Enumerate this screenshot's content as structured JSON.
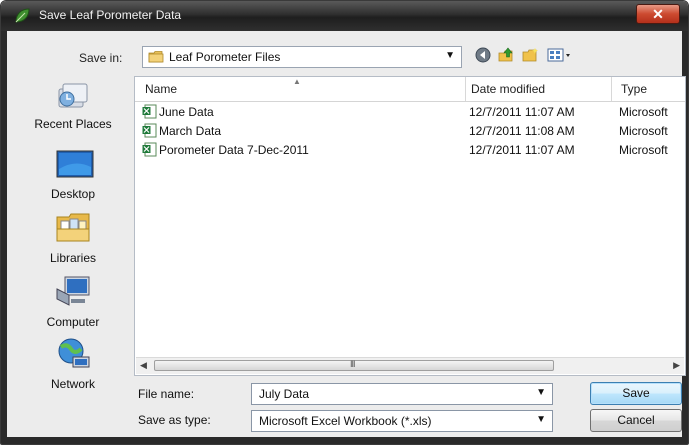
{
  "window": {
    "title": "Save Leaf Porometer Data",
    "close_symbol": "✕"
  },
  "save_in": {
    "label": "Save in:",
    "value": "Leaf Porometer Files"
  },
  "toolbar": {
    "icons": [
      "back-icon",
      "up-folder-icon",
      "new-folder-icon",
      "view-menu-icon"
    ]
  },
  "places": [
    {
      "label": "Recent Places",
      "icon": "recent-places-icon"
    },
    {
      "label": "Desktop",
      "icon": "desktop-icon"
    },
    {
      "label": "Libraries",
      "icon": "libraries-icon"
    },
    {
      "label": "Computer",
      "icon": "computer-icon"
    },
    {
      "label": "Network",
      "icon": "network-icon"
    }
  ],
  "columns": {
    "name": "Name",
    "date": "Date modified",
    "type": "Type"
  },
  "files": [
    {
      "name": "June Data",
      "date": "12/7/2011 11:07 AM",
      "type": "Microsoft"
    },
    {
      "name": "March Data",
      "date": "12/7/2011 11:08 AM",
      "type": "Microsoft"
    },
    {
      "name": "Porometer Data 7-Dec-2011",
      "date": "12/7/2011 11:07 AM",
      "type": "Microsoft"
    }
  ],
  "scrollbar": {
    "grip": "III"
  },
  "filename": {
    "label": "File name:",
    "value": "July Data"
  },
  "filetype": {
    "label": "Save as type:",
    "value": "Microsoft Excel Workbook (*.xls)"
  },
  "buttons": {
    "save": "Save",
    "cancel": "Cancel"
  },
  "colors": {
    "title_bar": "#2e2e2e",
    "close_button": "#cc4a30",
    "default_button": "#bee6fd",
    "excel_icon": "#1f7a3a"
  }
}
